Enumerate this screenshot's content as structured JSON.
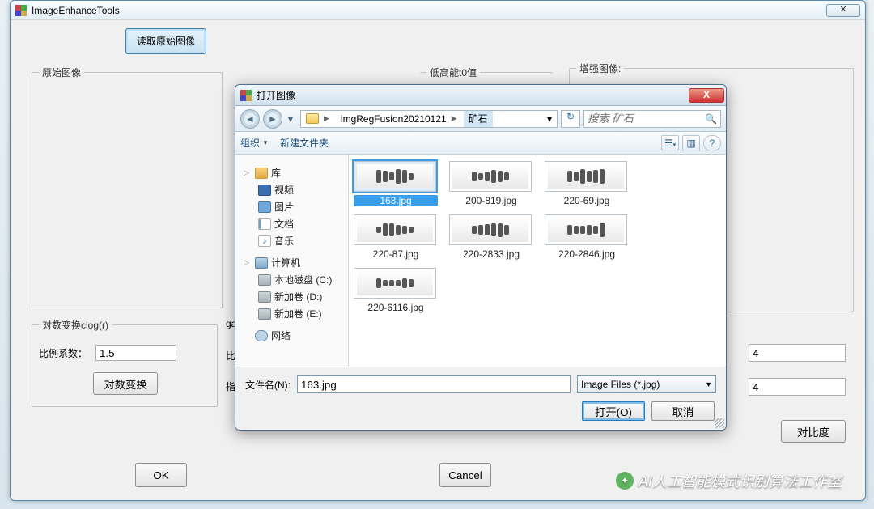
{
  "main": {
    "title": "ImageEnhanceTools",
    "readBtn": "读取原始图像",
    "origLegend": "原始图像",
    "lowLegend": "低高能t0值",
    "enhLegend": "增强图像:",
    "clogLegend": "对数变换clog(r)",
    "scaleLabel": "比例系数：",
    "scaleValue": "1.5",
    "logBtn": "对数变换",
    "gammaLabel": "gamm",
    "biliLabel": "比例",
    "zhishuLabel": "指数",
    "valR1": "4",
    "valR2": "4",
    "contrastBtn": "对比度",
    "ok": "OK",
    "cancel": "Cancel"
  },
  "dialog": {
    "title": "打开图像",
    "crumb1": "imgRegFusion20210121",
    "crumb2": "矿石",
    "searchPlaceholder": "搜索 矿石",
    "org": "组织",
    "newFolder": "新建文件夹",
    "side": {
      "lib": "库",
      "video": "视频",
      "pic": "图片",
      "doc": "文档",
      "music": "音乐",
      "computer": "计算机",
      "drvC": "本地磁盘 (C:)",
      "drvD": "新加卷 (D:)",
      "drvE": "新加卷 (E:)",
      "network": "网络"
    },
    "files": [
      "163.jpg",
      "200-819.jpg",
      "220-69.jpg",
      "220-87.jpg",
      "220-2833.jpg",
      "220-2846.jpg",
      "220-6116.jpg"
    ],
    "selected": "163.jpg",
    "fnLabel": "文件名(N):",
    "fnValue": "163.jpg",
    "filter": "Image Files (*.jpg)",
    "open": "打开(O)",
    "cancel": "取消"
  },
  "watermark": "AI人工智能模式识别算法工作室"
}
